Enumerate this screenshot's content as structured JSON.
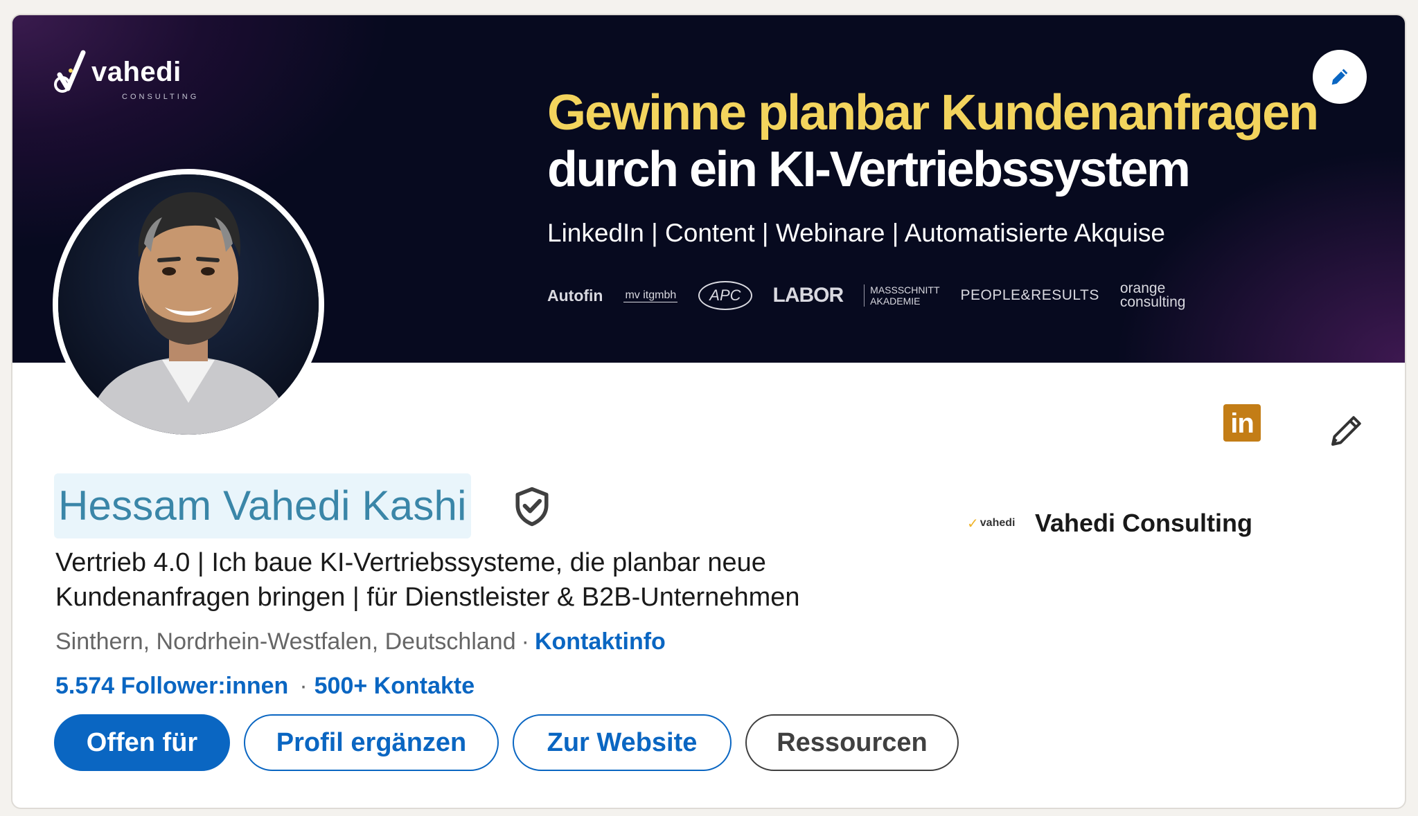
{
  "banner": {
    "brand_name": "vahedi",
    "brand_sub": "CONSULTING",
    "headline_line1": "Gewinne planbar Kundenanfragen",
    "headline_line2": "durch ein KI-Vertriebssystem",
    "subline": "LinkedIn | Content | Webinare | Automatisierte Akquise",
    "client_logos": {
      "autofin": "Autofin",
      "mv": "mv itgmbh",
      "apc": "APC",
      "labor": "LABOR",
      "massschnitt_1": "MASSSCHNITT",
      "massschnitt_2": "AKADEMIE",
      "people": "PEOPLE&RESULTS",
      "orange_1": "orange",
      "orange_2": "consulting"
    },
    "edit_icon": "pencil-icon"
  },
  "profile": {
    "name": "Hessam Vahedi Kashi",
    "verified_icon": "shield-check-icon",
    "headline": "Vertrieb 4.0 | Ich baue KI-Vertriebssysteme, die planbar neue Kundenanfragen bringen | für Dienstleister & B2B-Unternehmen",
    "location": "Sinthern, Nordrhein-Westfalen, Deutschland",
    "separator": "·",
    "contact_info": "Kontaktinfo",
    "followers": "5.574 Follower:innen",
    "connections": "500+ Kontakte",
    "linkedin_badge": "in",
    "edit_icon": "pencil-icon"
  },
  "company": {
    "logo_text": "vahedi",
    "name": "Vahedi Consulting"
  },
  "actions": {
    "open_to": "Offen für",
    "complete_profile": "Profil ergänzen",
    "website": "Zur Website",
    "resources": "Ressourcen"
  },
  "colors": {
    "accent": "#0a66c2",
    "banner_highlight": "#f3d45d",
    "name_color": "#3a86a8",
    "premium_badge": "#c37d16"
  }
}
